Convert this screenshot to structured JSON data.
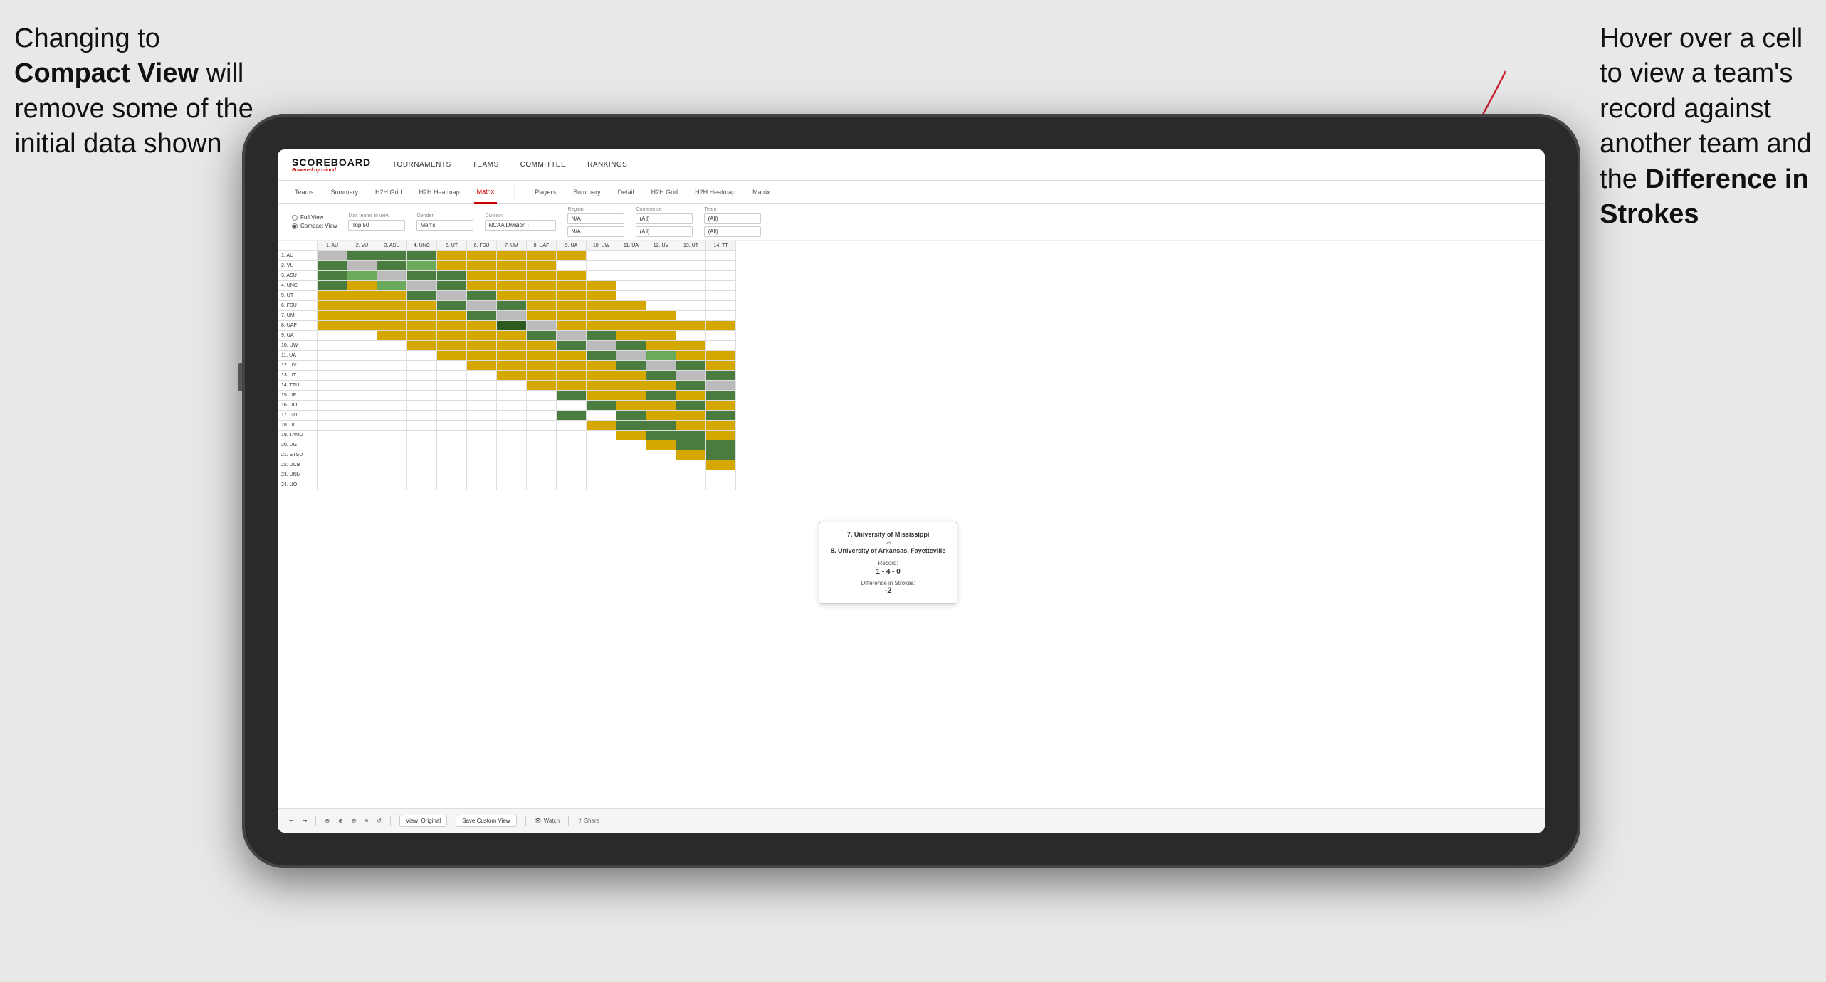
{
  "annotations": {
    "left": {
      "line1": "Changing to",
      "line2bold": "Compact View",
      "line2rest": " will",
      "line3": "remove some of the",
      "line4": "initial data shown"
    },
    "right": {
      "line1": "Hover over a cell",
      "line2": "to view a team's",
      "line3": "record against",
      "line4": "another team and",
      "line5bold": "the ",
      "line5boldtext": "Difference in",
      "line6bold": "Strokes"
    }
  },
  "nav": {
    "logo": "SCOREBOARD",
    "poweredBy": "Powered by",
    "brand": "clippd",
    "items": [
      "TOURNAMENTS",
      "TEAMS",
      "COMMITTEE",
      "RANKINGS"
    ]
  },
  "subNav": {
    "left": [
      "Teams",
      "Summary",
      "H2H Grid",
      "H2H Heatmap",
      "Matrix"
    ],
    "right": [
      "Players",
      "Summary",
      "Detail",
      "H2H Grid",
      "H2H Heatmap",
      "Matrix"
    ],
    "active": "Matrix"
  },
  "filters": {
    "viewOptions": [
      "Full View",
      "Compact View"
    ],
    "selectedView": "Compact View",
    "maxTeams": {
      "label": "Max teams in view",
      "value": "Top 50"
    },
    "gender": {
      "label": "Gender",
      "value": "Men's"
    },
    "division": {
      "label": "Division",
      "value": "NCAA Division I"
    },
    "region": {
      "label": "Region",
      "value": "N/A"
    },
    "conference": {
      "label": "Conference",
      "value": "(All)"
    },
    "team": {
      "label": "Team",
      "value": "(All)"
    }
  },
  "columns": [
    "1. AU",
    "2. VU",
    "3. ASU",
    "4. UNC",
    "5. UT",
    "6. FSU",
    "7. UM",
    "8. UAF",
    "9. UA",
    "10. UW",
    "11. UA",
    "12. UV",
    "13. UT",
    "14. TT"
  ],
  "rows": [
    "1. AU",
    "2. VU",
    "3. ASU",
    "4. UNC",
    "5. UT",
    "6. FSU",
    "7. UM",
    "8. UAF",
    "9. UA",
    "10. UW",
    "11. UA",
    "12. UV",
    "13. UT",
    "14. TTU",
    "15. UF",
    "16. UO",
    "17. GIT",
    "18. UI",
    "19. TAMU",
    "20. UG",
    "21. ETSU",
    "22. UCB",
    "23. UNM",
    "24. UO"
  ],
  "tooltip": {
    "team1": "7. University of Mississippi",
    "vs": "vs",
    "team2": "8. University of Arkansas, Fayetteville",
    "recordLabel": "Record:",
    "recordValue": "1 - 4 - 0",
    "diffLabel": "Difference in Strokes:",
    "diffValue": "-2"
  },
  "toolbar": {
    "buttons": [
      "↩",
      "↪",
      "⟲",
      "⊕",
      "⊖",
      "≡",
      "↺"
    ],
    "viewOriginal": "View: Original",
    "saveCustomView": "Save Custom View",
    "watch": "Watch",
    "share": "Share"
  }
}
